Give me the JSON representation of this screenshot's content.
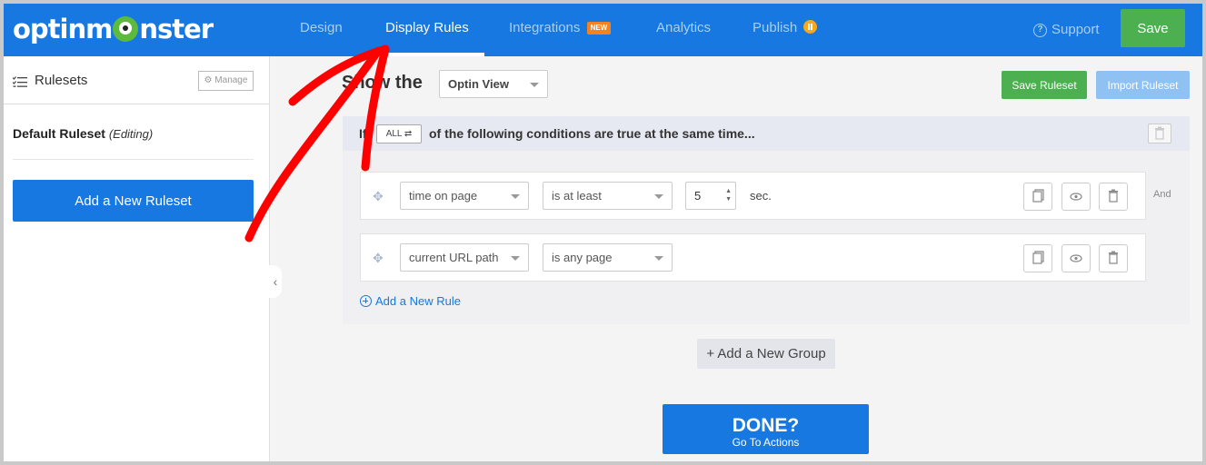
{
  "header": {
    "logo_text_left": "optinm",
    "logo_text_right": "nster",
    "nav": [
      {
        "label": "Design"
      },
      {
        "label": "Display Rules"
      },
      {
        "label": "Integrations",
        "badge": "NEW"
      },
      {
        "label": "Analytics"
      },
      {
        "label": "Publish"
      }
    ],
    "support_label": "Support",
    "save_label": "Save"
  },
  "sidebar": {
    "title": "Rulesets",
    "manage_label": "Manage",
    "ruleset_name": "Default Ruleset",
    "ruleset_state": "(Editing)",
    "add_label": "Add a New Ruleset",
    "collapse_glyph": "‹"
  },
  "main": {
    "show_the": "Show the",
    "view_select": "Optin View",
    "save_ruleset": "Save Ruleset",
    "import_ruleset": "Import Ruleset",
    "group": {
      "if_label": "If",
      "match_label": "ALL ⇄",
      "condition_text": "of the following conditions are true at the same time...",
      "rules": [
        {
          "field": "time on page",
          "operator": "is at least",
          "value": "5",
          "unit": "sec."
        },
        {
          "field": "current URL path",
          "operator": "is any page"
        }
      ],
      "and_label": "And",
      "add_rule_label": "Add a New Rule"
    },
    "add_group_label": "+ Add a New Group",
    "done_title": "DONE?",
    "done_subtitle": "Go To Actions"
  },
  "colors": {
    "brand_blue": "#1678e0",
    "save_green": "#4caf50",
    "annotation_red": "#ff0000"
  }
}
